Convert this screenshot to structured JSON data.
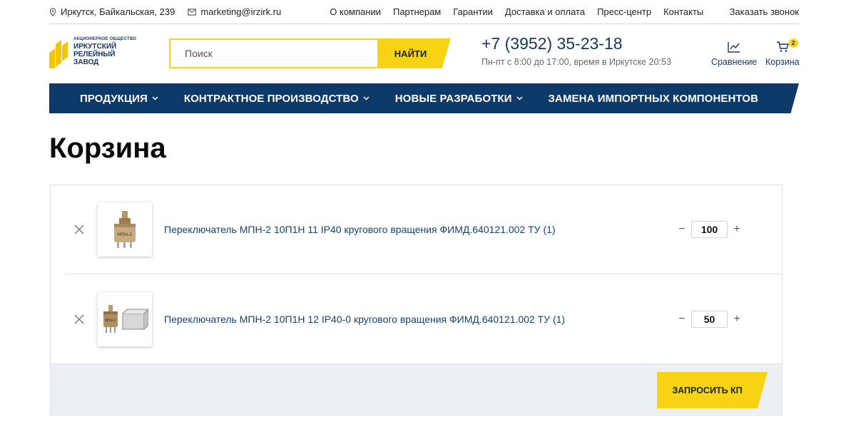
{
  "topbar": {
    "address": "Иркутск, Байкальская, 239",
    "email": "marketing@irzirk.ru",
    "links": [
      "О компании",
      "Партнерам",
      "Гарантии",
      "Доставка и оплата",
      "Пресс-центр",
      "Контакты"
    ],
    "callback": "Заказать звонок"
  },
  "logo": {
    "small": "АКЦИОНЕРНОЕ ОБЩЕСТВО",
    "line1": "ИРКУТСКИЙ",
    "line2": "РЕЛЕЙНЫЙ",
    "line3": "ЗАВОД"
  },
  "search": {
    "placeholder": "Поиск",
    "button": "НАЙТИ"
  },
  "contact": {
    "phone": "+7 (3952) 35-23-18",
    "hours": "Пн-пт с 8:00 до 17:00, время в Иркутске 20:53"
  },
  "header_icons": {
    "compare": "Сравнение",
    "cart": "Корзина",
    "cart_count": "2"
  },
  "mainnav": [
    {
      "label": "ПРОДУКЦИЯ"
    },
    {
      "label": "КОНТРАКТНОЕ ПРОИЗВОДСТВО"
    },
    {
      "label": "НОВЫЕ РАЗРАБОТКИ"
    },
    {
      "label": "ЗАМЕНА ИМПОРТНЫХ КОМПОНЕНТОВ"
    }
  ],
  "page_title": "Корзина",
  "cart": {
    "items": [
      {
        "name": "Переключатель МПН-2 10П1Н 11 IP40 кругового вращения ФИМД.640121.002 ТУ (1)",
        "quantity": "100",
        "thumb_text": "МПН-2"
      },
      {
        "name": "Переключатель МПН-2 10П1Н 12 IP40-0 кругового вращения ФИМД.640121.002 ТУ (1)",
        "quantity": "50",
        "thumb_text": "МПН-2"
      }
    ],
    "request_button": "ЗАПРОСИТЬ КП"
  },
  "colors": {
    "accent": "#f7d314",
    "navy": "#0e3a6a",
    "link": "#14436e"
  }
}
